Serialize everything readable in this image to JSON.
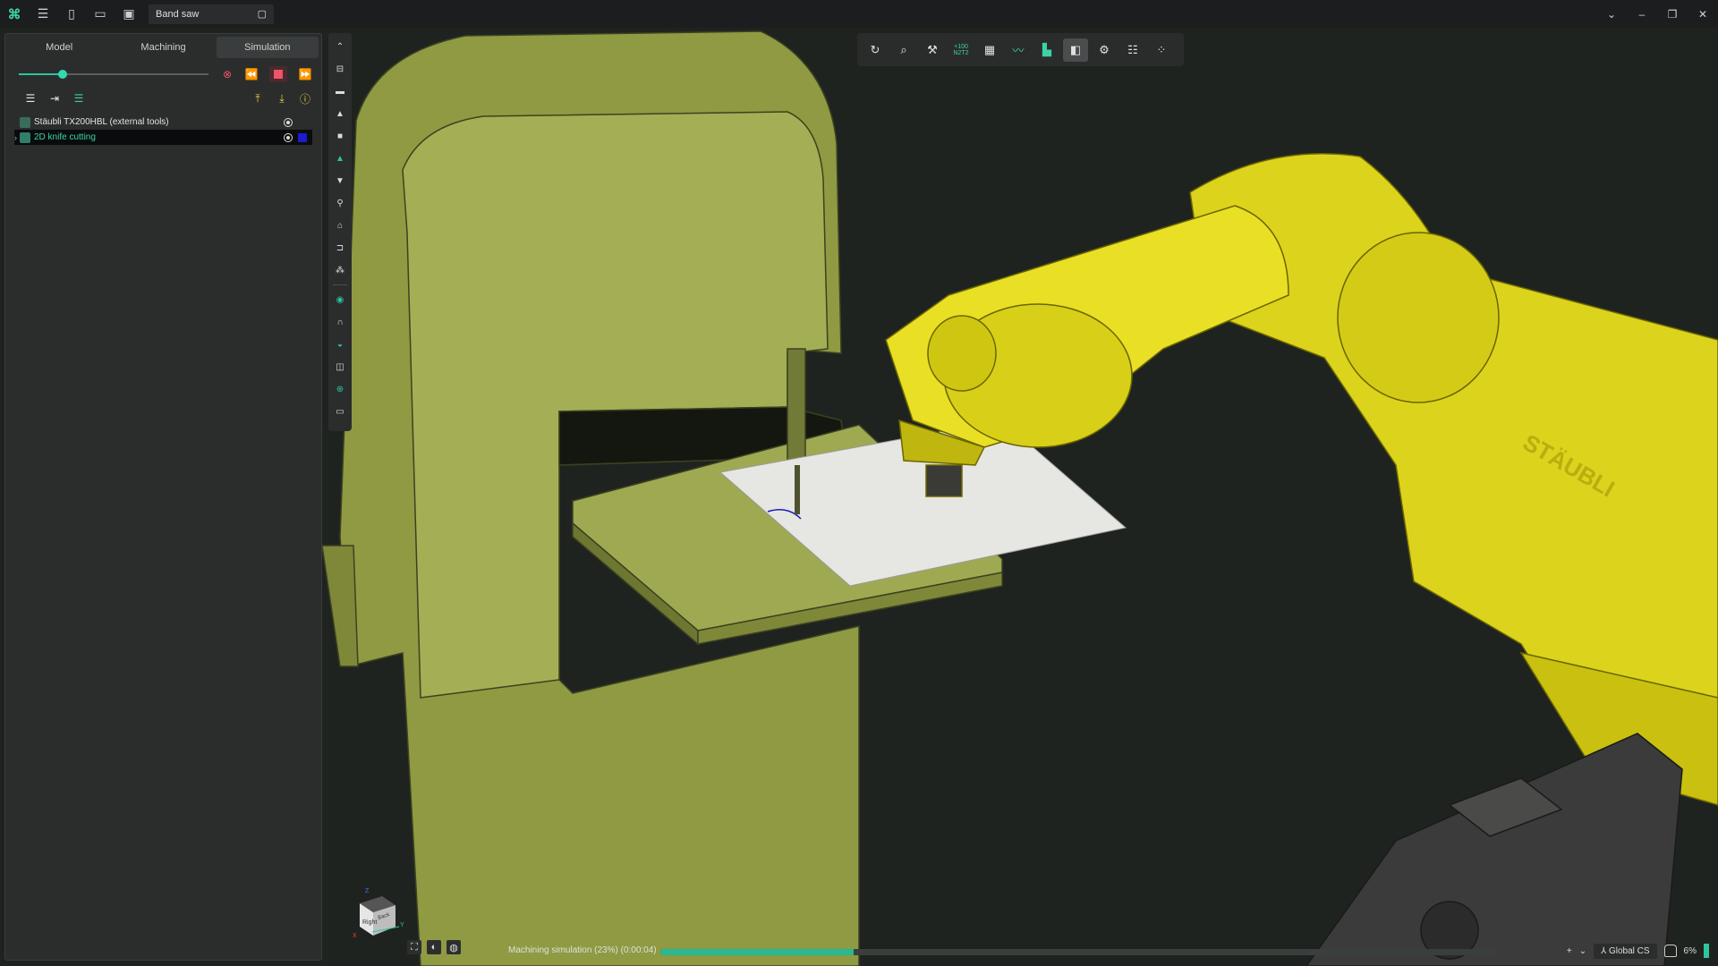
{
  "titlebar": {
    "document_name": "Band saw",
    "icons": [
      "app-logo-icon",
      "menu-icon",
      "new-file-icon",
      "open-folder-icon",
      "save-icon"
    ]
  },
  "panel": {
    "tabs": [
      {
        "label": "Model",
        "active": false
      },
      {
        "label": "Machining",
        "active": false
      },
      {
        "label": "Simulation",
        "active": true
      }
    ],
    "simulation_progress": 0.23,
    "tree": [
      {
        "label": "Stäubli TX200HBL (external tools)",
        "selected": false
      },
      {
        "label": "2D knife cutting",
        "selected": true,
        "color": "#1b1bd0"
      }
    ]
  },
  "toolbar_top": {
    "zoom_text_top": "+100",
    "zoom_text_bottom": "N2T2"
  },
  "viewcube": {
    "face_front": "Right",
    "face_right": "Back",
    "axis_x": "X",
    "axis_y": "Y",
    "axis_z": "Z"
  },
  "status": {
    "text": "Machining simulation (23%) (0:00:04)",
    "progress": 0.23,
    "coordinate_system": "Global CS",
    "percent": "6%"
  },
  "colors": {
    "accent": "#2ec4a0",
    "robot": "#e8e020",
    "bandsaw": "#9aa54a",
    "background": "#1f2320"
  }
}
